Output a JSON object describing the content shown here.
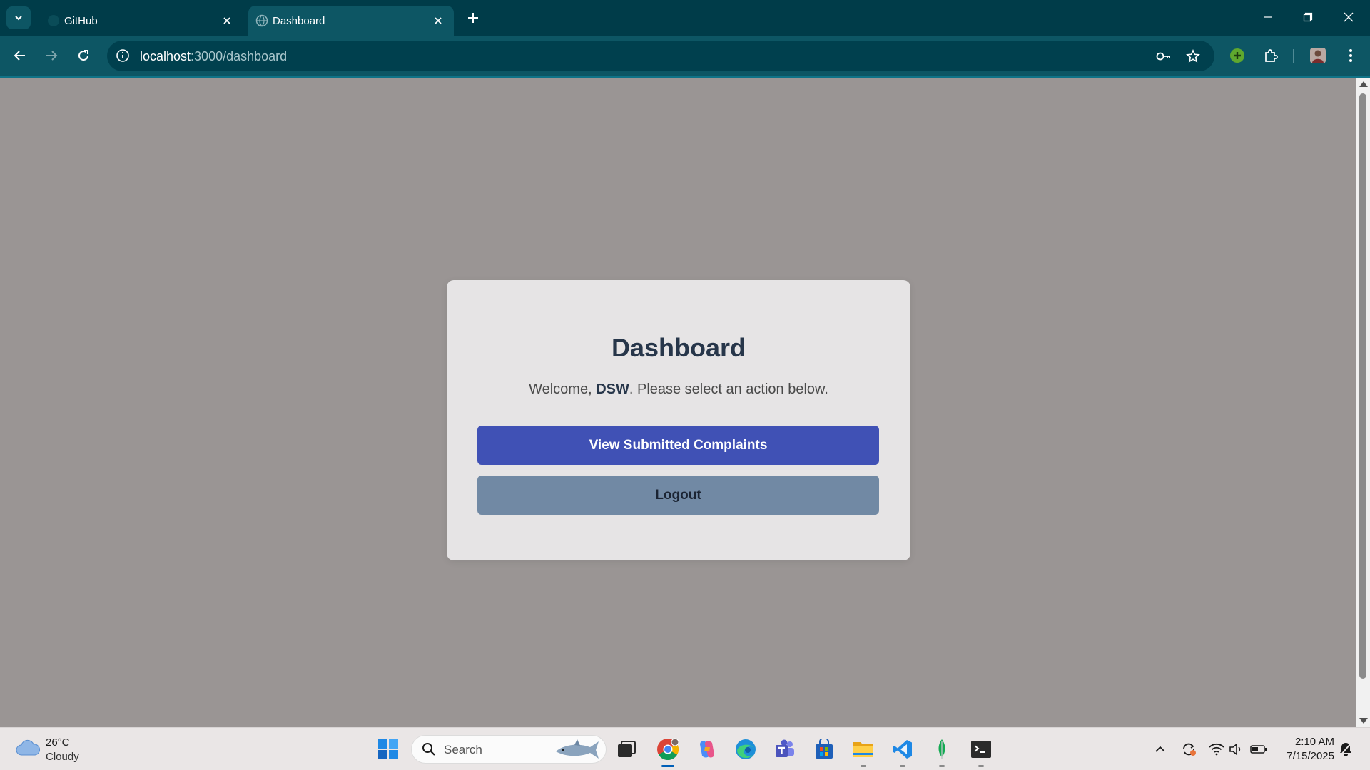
{
  "browser": {
    "tabs": [
      {
        "title": "GitHub",
        "active": false
      },
      {
        "title": "Dashboard",
        "active": true
      }
    ],
    "url_host": "localhost",
    "url_path": ":3000/dashboard"
  },
  "page": {
    "title": "Dashboard",
    "welcome_prefix": "Welcome, ",
    "username": "DSW",
    "welcome_suffix": ". Please select an action below.",
    "primary_button": "View Submitted Complaints",
    "secondary_button": "Logout"
  },
  "colors": {
    "tabbar": "#003c49",
    "toolbar": "#0d5664",
    "page_background": "#9a9594",
    "card": "#e6e4e5",
    "primary_button": "#4051b5",
    "secondary_button": "#7189a4"
  },
  "taskbar": {
    "weather_temp": "26°C",
    "weather_condition": "Cloudy",
    "search_placeholder": "Search",
    "time": "2:10 AM",
    "date": "7/15/2025",
    "apps": [
      "windows-start-icon",
      "task-view-icon",
      "chrome-icon",
      "copilot-icon",
      "edge-icon",
      "teams-icon",
      "store-icon",
      "file-explorer-icon",
      "vscode-icon",
      "mongodb-icon",
      "terminal-icon"
    ]
  }
}
